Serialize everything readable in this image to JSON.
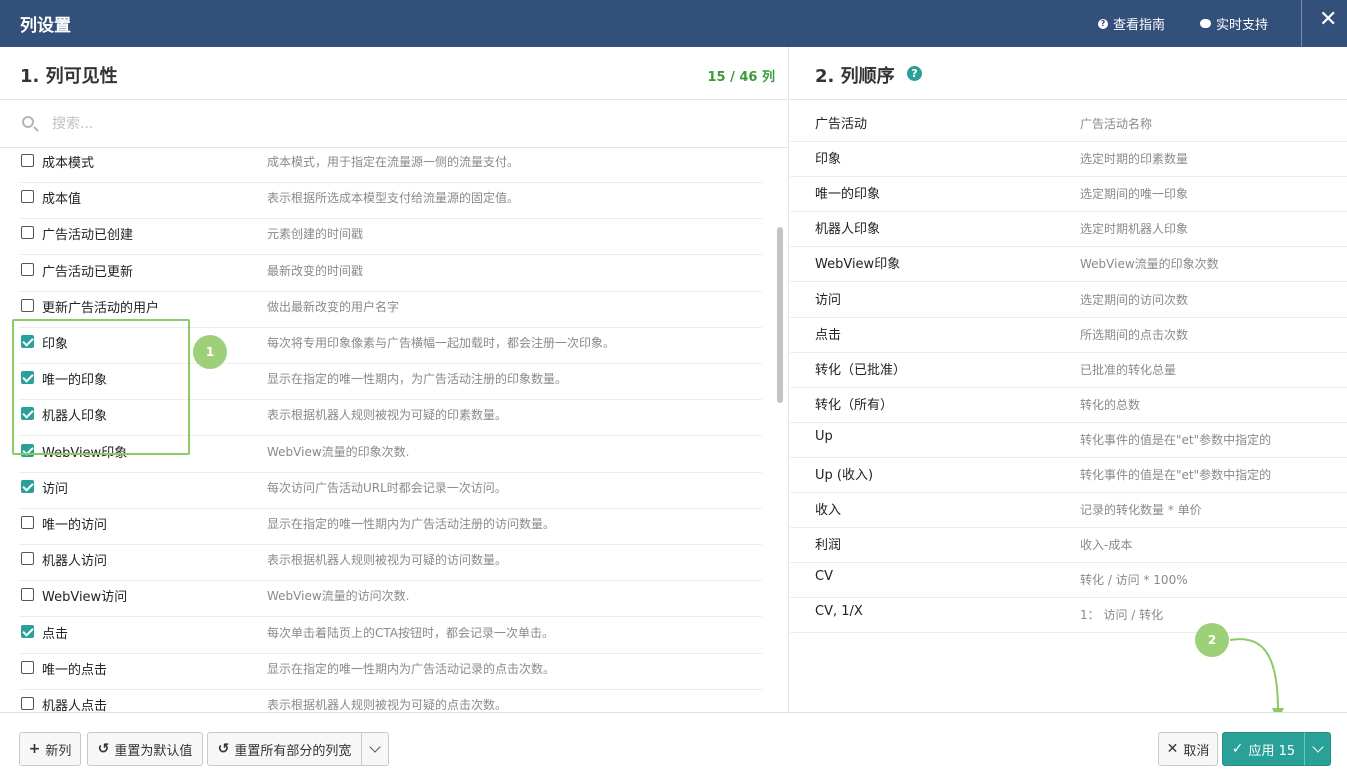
{
  "header": {
    "title": "列设置",
    "guide_label": "查看指南",
    "support_label": "实时支持",
    "close_glyph": "✕"
  },
  "visibility": {
    "heading": "1. 列可见性",
    "count": "15 / 46 列",
    "search_placeholder": "搜索...",
    "rows": [
      {
        "name": "成本模式",
        "desc": "成本模式，用于指定在流量源一侧的流量支付。",
        "checked": false
      },
      {
        "name": "成本值",
        "desc": "表示根据所选成本模型支付给流量源的固定值。",
        "checked": false
      },
      {
        "name": "广告活动已创建",
        "desc": "元素创建的时间戳",
        "checked": false
      },
      {
        "name": "广告活动已更新",
        "desc": "最新改变的时间戳",
        "checked": false
      },
      {
        "name": "更新广告活动的用户",
        "desc": "做出最新改变的用户名字",
        "checked": false
      },
      {
        "name": "印象",
        "desc": "每次将专用印象像素与广告横幅一起加载时，都会注册一次印象。",
        "checked": true
      },
      {
        "name": "唯一的印象",
        "desc": "显示在指定的唯一性期内，为广告活动注册的印象数量。",
        "checked": true
      },
      {
        "name": "机器人印象",
        "desc": "表示根据机器人规则被视为可疑的印素数量。",
        "checked": true
      },
      {
        "name": "WebView印象",
        "desc": "WebView流量的印象次数.",
        "checked": true
      },
      {
        "name": "访问",
        "desc": "每次访问广告活动URL时都会记录一次访问。",
        "checked": true
      },
      {
        "name": "唯一的访问",
        "desc": "显示在指定的唯一性期内为广告活动注册的访问数量。",
        "checked": false
      },
      {
        "name": "机器人访问",
        "desc": "表示根据机器人规则被视为可疑的访问数量。",
        "checked": false
      },
      {
        "name": "WebView访问",
        "desc": "WebView流量的访问次数.",
        "checked": false
      },
      {
        "name": "点击",
        "desc": "每次单击着陆页上的CTA按钮时，都会记录一次单击。",
        "checked": true
      },
      {
        "name": "唯一的点击",
        "desc": "显示在指定的唯一性期内为广告活动记录的点击次数。",
        "checked": false
      },
      {
        "name": "机器人点击",
        "desc": "表示根据机器人规则被视为可疑的点击次数。",
        "checked": false
      }
    ]
  },
  "order": {
    "heading": "2. 列顺序",
    "help_glyph": "?",
    "rows": [
      {
        "name": "广告活动",
        "desc": "广告活动名称"
      },
      {
        "name": "印象",
        "desc": "选定时期的印素数量"
      },
      {
        "name": "唯一的印象",
        "desc": "选定期间的唯一印象"
      },
      {
        "name": "机器人印象",
        "desc": "选定时期机器人印象"
      },
      {
        "name": "WebView印象",
        "desc": "WebView流量的印象次数"
      },
      {
        "name": "访问",
        "desc": "选定期间的访问次数"
      },
      {
        "name": "点击",
        "desc": "所选期间的点击次数"
      },
      {
        "name": "转化（已批准）",
        "desc": "已批准的转化总量"
      },
      {
        "name": "转化（所有）",
        "desc": "转化的总数"
      },
      {
        "name": "Up",
        "desc": "转化事件的值是在\"et\"参数中指定的"
      },
      {
        "name": "Up (收入)",
        "desc": "转化事件的值是在\"et\"参数中指定的"
      },
      {
        "name": "收入",
        "desc": "记录的转化数量 * 单价"
      },
      {
        "name": "利润",
        "desc": "收入-成本"
      },
      {
        "name": "CV",
        "desc": "转化 / 访问 * 100%"
      },
      {
        "name": "CV, 1/X",
        "desc": "1： 访问 / 转化"
      }
    ]
  },
  "footer": {
    "new_column": "新列",
    "reset_default": "重置为默认值",
    "reset_widths": "重置所有部分的列宽",
    "cancel": "取消",
    "apply": "应用 15"
  },
  "annotations": {
    "badge_1": "1",
    "badge_2": "2"
  },
  "colors": {
    "header_bg": "#33507a",
    "accent": "#2aa198",
    "highlight": "#8dc869",
    "count_green": "#3a9c3a"
  }
}
